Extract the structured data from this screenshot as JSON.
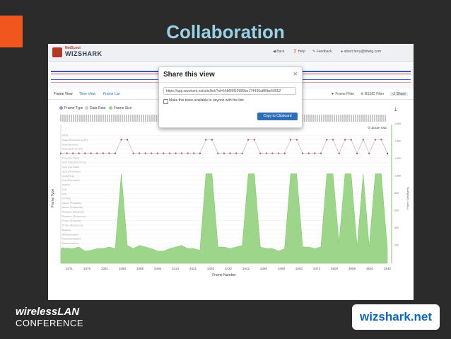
{
  "slide": {
    "title": "Collaboration",
    "accent_color": "#f0561d",
    "title_color": "#9ad0e6"
  },
  "app": {
    "logo_small": "NetScout",
    "logo_text": "WIZSHARK",
    "nav": {
      "back": "Back",
      "help": "Help",
      "feedback": "Feedback",
      "user": "albert.ferry@bitwig.com"
    },
    "tabs": [
      {
        "label": "Frame View"
      },
      {
        "label": "Time View"
      },
      {
        "label": "Frame List"
      }
    ],
    "filters": {
      "frame_filter": "Frame Filter",
      "bssid_filter": "BSSID Filter",
      "share": "Share"
    },
    "legend": [
      {
        "label": "Frame Type",
        "color": "#8a9bd8"
      },
      {
        "label": "Data Rate",
        "color": "#cccccc"
      },
      {
        "label": "Frame Size",
        "color": "#9dd68a"
      }
    ],
    "zoom_out": "Zoom Out"
  },
  "modal": {
    "title": "Share this view",
    "url": "https://app.wizshark.net/site/link?id=54b6f0f10989be174436a8f0be50652",
    "checkbox_label": "Make this trace available to anyone with the link",
    "button": "Copy to Clipboard"
  },
  "chart_data": {
    "type": "area",
    "xlabel": "Frame Number",
    "ylabel": "Frame Type",
    "y2label": "Frame Size(Bytes)",
    "x_ticks": [
      "3371",
      "3376",
      "3381",
      "3390",
      "3398",
      "3406",
      "3414",
      "3421",
      "3426",
      "3432",
      "3442",
      "3450",
      "3458",
      "3463",
      "3472",
      "3500",
      "3508",
      "3520",
      "3540"
    ],
    "y2_ticks": [
      "1,600",
      "1,400",
      "1,200",
      "1,000",
      "800",
      "600",
      "400",
      "200"
    ],
    "frame_types": [
      "ATIM",
      "Data (Received by AP)",
      "Data (Unsent)",
      "Data (Sent by AP)",
      "",
      "Data (No Data)",
      "QoS Data (Received)",
      "QoS (No Data)",
      "QoS (Received)",
      "QoS(Sent)",
      "Null (Received)",
      "PSPoll",
      "Null",
      "Ack",
      "CF-Ack",
      "Assoc (Request)",
      "Assoc (Response)",
      "Reassoc (Request)",
      "Reassoc (Response)",
      "Probe (Request)",
      "Probe (Response)",
      "Beacon",
      "Authentication",
      "Deauthentication",
      "Disassociation",
      "Action",
      "RTS",
      "CTS",
      "CF-End"
    ],
    "frame_size": [
      180,
      180,
      180,
      200,
      150,
      160,
      180,
      180,
      200,
      180,
      1100,
      220,
      180,
      220,
      200,
      180,
      150,
      150,
      180,
      200,
      220,
      180,
      180,
      160,
      1100,
      1100,
      200,
      200,
      180,
      200,
      220,
      1100,
      1100,
      200,
      180,
      180,
      150,
      180,
      1100,
      1100,
      200,
      200,
      180,
      200,
      1100,
      1100,
      250,
      1100,
      1100,
      200,
      1100,
      200,
      1100,
      1100,
      180
    ],
    "frame_type_rate": [
      0,
      0,
      0,
      0,
      0,
      0,
      0,
      0,
      0,
      0,
      1,
      1,
      0,
      0,
      0,
      0,
      0,
      0,
      0,
      0,
      0,
      0,
      0,
      0,
      1,
      1,
      0,
      0,
      0,
      0,
      0,
      1,
      1,
      0,
      0,
      0,
      0,
      0,
      1,
      1,
      0,
      0,
      0,
      0,
      1,
      1,
      0,
      1,
      1,
      0,
      1,
      0,
      1,
      1,
      0
    ]
  }
}
